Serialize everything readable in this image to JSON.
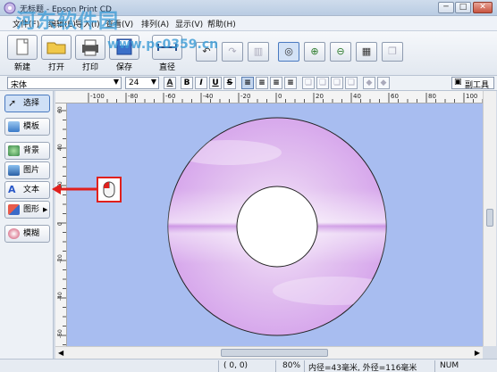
{
  "window": {
    "title": "无标题 - Epson Print CD",
    "minimize": "─",
    "maximize": "□",
    "close": "✕"
  },
  "menu": [
    "文件(F)",
    "编辑(E)",
    "导入(I)",
    "查看(V)",
    "排列(A)",
    "显示(V)",
    "帮助(H)"
  ],
  "toolbar": {
    "buttons": [
      {
        "label": "新建",
        "icon": "new-icon"
      },
      {
        "label": "打开",
        "icon": "open-folder-icon"
      },
      {
        "label": "打印",
        "icon": "printer-icon"
      },
      {
        "label": "保存",
        "icon": "save-icon"
      },
      {
        "label": "直径",
        "icon": "diameter-icon"
      }
    ],
    "tools": [
      {
        "icon": "undo-icon",
        "glyph": "↶",
        "enabled": true
      },
      {
        "icon": "redo-icon",
        "glyph": "↷",
        "enabled": false
      },
      {
        "icon": "trash-icon",
        "glyph": "▥",
        "enabled": false
      },
      {
        "icon": "disc-view-icon",
        "glyph": "◎",
        "enabled": true
      },
      {
        "icon": "zoom-in-icon",
        "glyph": "⊕",
        "enabled": true
      },
      {
        "icon": "zoom-out-icon",
        "glyph": "⊖",
        "enabled": true
      },
      {
        "icon": "grid-icon",
        "glyph": "▦",
        "enabled": true
      },
      {
        "icon": "layers-icon",
        "glyph": "❐",
        "enabled": false
      }
    ]
  },
  "fontbar": {
    "font": "宋体",
    "size": "24",
    "format": [
      "A",
      "B",
      "I",
      "U",
      "S"
    ],
    "draw_tools_label": "副工具"
  },
  "sidebar": [
    {
      "label": "选择",
      "icon": "select-arrow-icon",
      "color": "#2c5aa0",
      "active": true
    },
    {
      "label": "模板",
      "icon": "template-icon",
      "color": "#4a8fd0"
    },
    {
      "label": "背景",
      "icon": "background-icon",
      "color": "#4aa35a"
    },
    {
      "label": "图片",
      "icon": "picture-icon",
      "color": "#2a6fb5"
    },
    {
      "label": "文本",
      "icon": "text-icon",
      "color": "#2a58c8"
    },
    {
      "label": "图形",
      "icon": "shape-icon",
      "color": "#c84a3a"
    },
    {
      "label": "模糊",
      "icon": "blur-icon",
      "color": "#c43d5c"
    }
  ],
  "ruler": {
    "top_labels": [
      "-100",
      "-80",
      "-60",
      "-40",
      "-20",
      "0",
      "20",
      "40",
      "60",
      "80",
      "100"
    ],
    "left_labels": [
      "60",
      "40",
      "20",
      "0",
      "-20",
      "-40",
      "-60"
    ]
  },
  "statusbar": {
    "coords": "(  0,  0)",
    "zoom": "80%",
    "disc": "内径=43毫米, 外径=116毫米",
    "mode": "NUM"
  },
  "watermark": {
    "text": "河东软件园",
    "url": "www.pc0359.cn"
  },
  "colors": {
    "canvas": "#a8bdf0",
    "disc": "#e3c3f0",
    "callout": "#e0201c"
  }
}
